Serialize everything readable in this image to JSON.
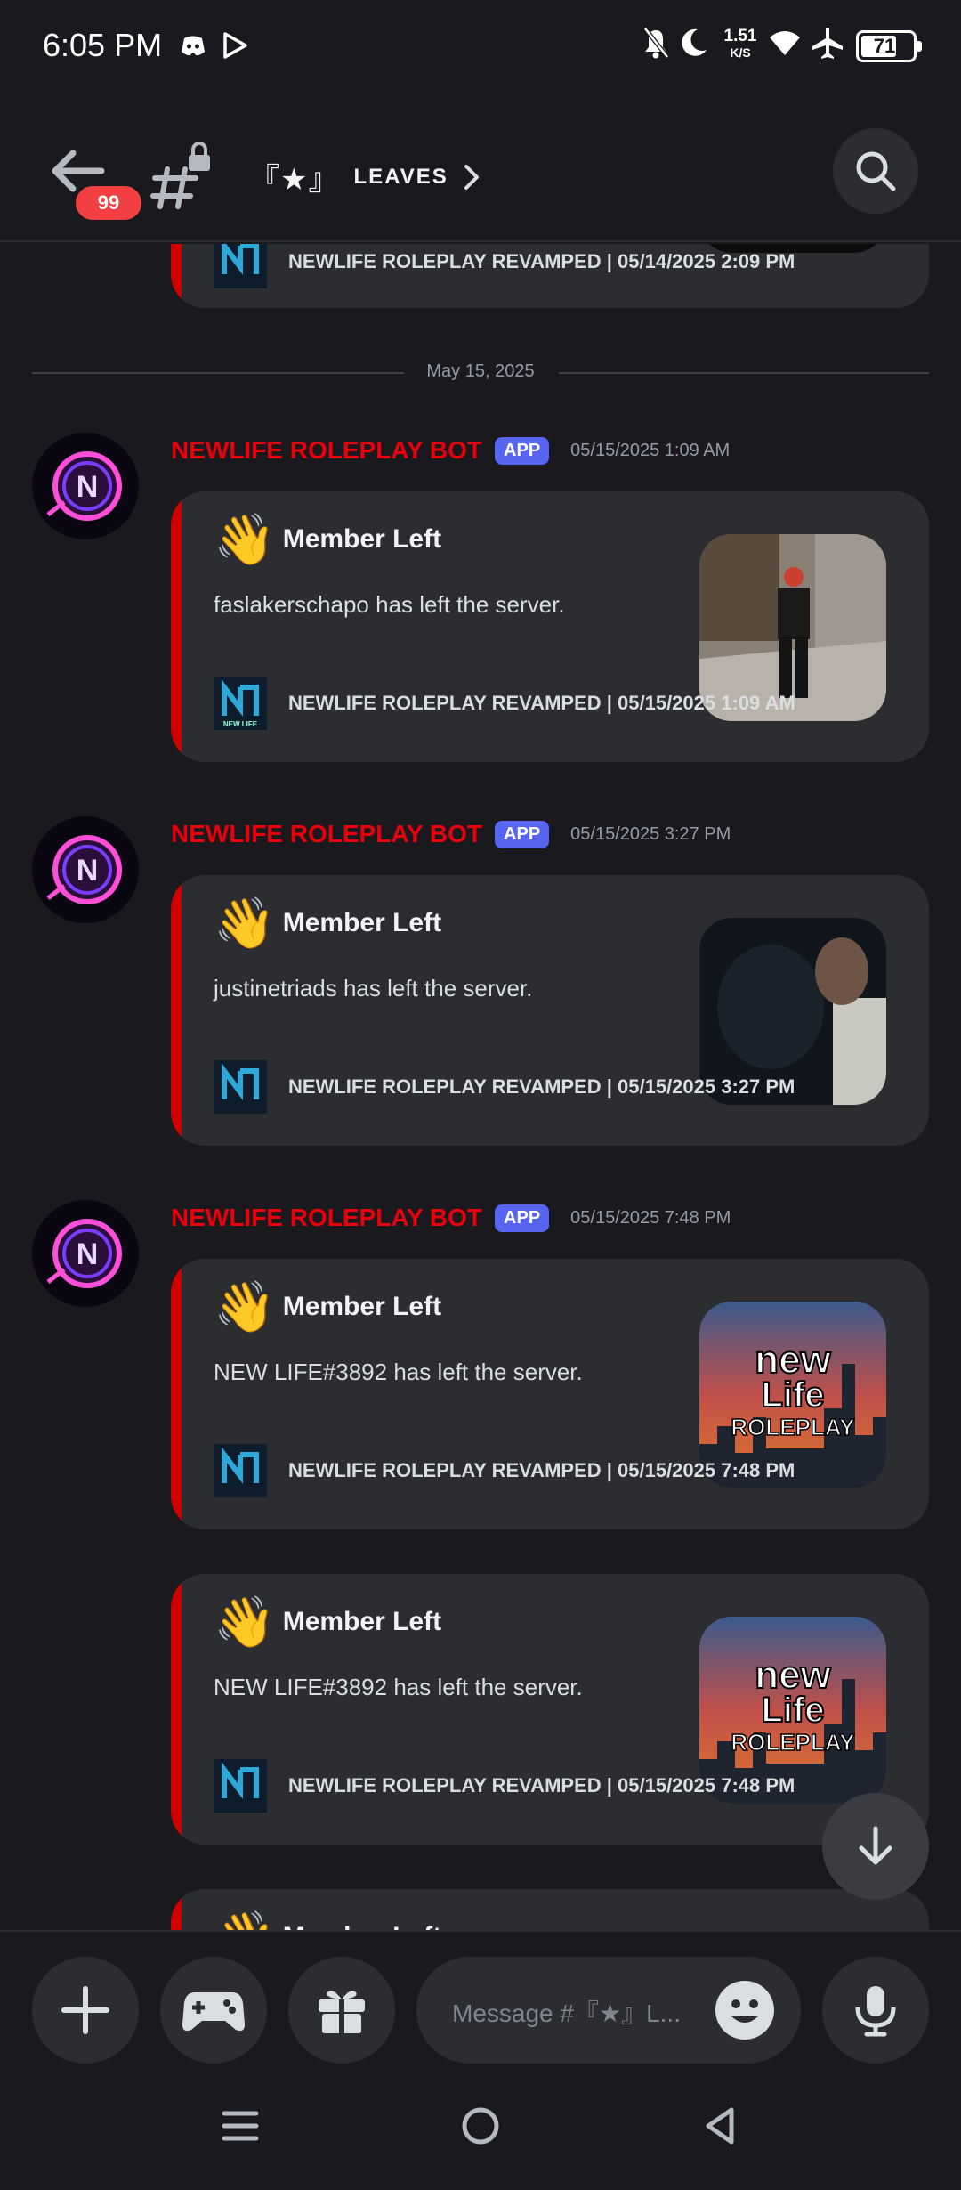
{
  "status_bar": {
    "time": "6:05 PM",
    "net_speed_value": "1.51",
    "net_speed_unit": "K/S",
    "battery": "71"
  },
  "header": {
    "badge_count": "99",
    "channel_symbol": "『★』",
    "channel_name": "LEAVES"
  },
  "partial_top": {
    "footer": "NEWLIFE ROLEPLAY REVAMPED | 05/14/2025 2:09 PM"
  },
  "date_divider": "May 15, 2025",
  "messages": [
    {
      "author": "NEWLIFE ROLEPLAY BOT",
      "tag": "APP",
      "timestamp": "05/15/2025 1:09 AM",
      "embeds": [
        {
          "title": "Member Left",
          "description": "faslakerschapo has left the server.",
          "footer": "NEWLIFE ROLEPLAY REVAMPED | 05/15/2025 1:09 AM"
        }
      ]
    },
    {
      "author": "NEWLIFE ROLEPLAY BOT",
      "tag": "APP",
      "timestamp": "05/15/2025 3:27 PM",
      "embeds": [
        {
          "title": "Member Left",
          "description": "justinetriads has left the server.",
          "footer": "NEWLIFE ROLEPLAY REVAMPED | 05/15/2025 3:27 PM"
        }
      ]
    },
    {
      "author": "NEWLIFE ROLEPLAY BOT",
      "tag": "APP",
      "timestamp": "05/15/2025 7:48 PM",
      "embeds": [
        {
          "title": "Member Left",
          "description": "NEW LIFE#3892 has left the server.",
          "footer": "NEWLIFE ROLEPLAY REVAMPED | 05/15/2025 7:48 PM"
        },
        {
          "title": "Member Left",
          "description": "NEW LIFE#3892 has left the server.",
          "footer": "NEWLIFE ROLEPLAY REVAMPED | 05/15/2025 7:48 PM"
        }
      ]
    }
  ],
  "partial_bottom_title": "Member Left",
  "thumbnail_logo": [
    "new",
    "Life",
    "ROLEPLAY"
  ],
  "footer_logo_text": "NEW LIFE",
  "composer": {
    "placeholder": "Message #『★』L..."
  },
  "colors": {
    "background": "#1a1a1e",
    "embed_bg": "#2b2d31",
    "embed_accent": "#d00000",
    "author": "#e8000d",
    "app_tag": "#5865f2",
    "badge": "#f23f43"
  },
  "icons": [
    "back-arrow-icon",
    "locked-channel-icon",
    "chevron-right-icon",
    "search-icon",
    "plus-icon",
    "gamepad-icon",
    "gift-icon",
    "emoji-icon",
    "mic-icon",
    "arrow-down-icon",
    "menu-icon",
    "home-icon",
    "back-icon",
    "wave-emoji"
  ]
}
